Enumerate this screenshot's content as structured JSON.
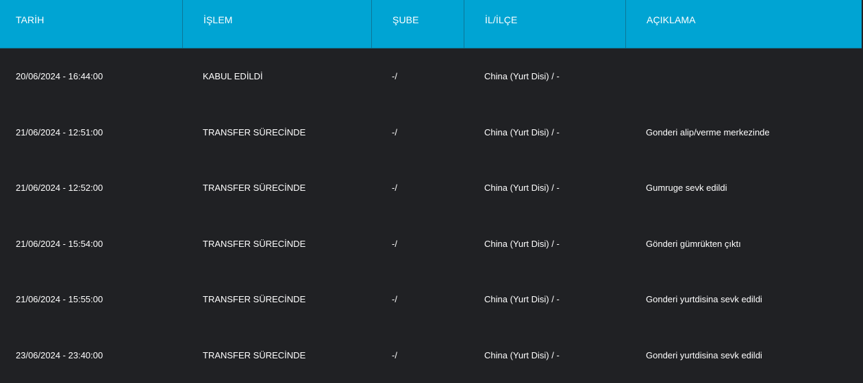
{
  "headers": {
    "date": "TARİH",
    "operation": "İŞLEM",
    "branch": "ŞUBE",
    "city": "İL/İLÇE",
    "description": "AÇIKLAMA"
  },
  "rows": [
    {
      "date": "20/06/2024 - 16:44:00",
      "operation": "KABUL EDİLDİ",
      "branch": "-/",
      "city": "China (Yurt Disi) / -",
      "description": ""
    },
    {
      "date": "21/06/2024 - 12:51:00",
      "operation": "TRANSFER SÜRECİNDE",
      "branch": "-/",
      "city": "China (Yurt Disi) / -",
      "description": "Gonderi alip/verme merkezinde"
    },
    {
      "date": "21/06/2024 - 12:52:00",
      "operation": "TRANSFER SÜRECİNDE",
      "branch": "-/",
      "city": "China (Yurt Disi) / -",
      "description": "Gumruge sevk edildi"
    },
    {
      "date": "21/06/2024 - 15:54:00",
      "operation": "TRANSFER SÜRECİNDE",
      "branch": "-/",
      "city": "China (Yurt Disi) / -",
      "description": "Gönderi gümrükten çıktı"
    },
    {
      "date": "21/06/2024 - 15:55:00",
      "operation": "TRANSFER SÜRECİNDE",
      "branch": "-/",
      "city": "China (Yurt Disi) / -",
      "description": "Gonderi yurtdisina sevk edildi"
    },
    {
      "date": "23/06/2024 - 23:40:00",
      "operation": "TRANSFER SÜRECİNDE",
      "branch": "-/",
      "city": "China (Yurt Disi) / -",
      "description": "Gonderi yurtdisina sevk edildi"
    }
  ],
  "colors": {
    "header_bg": "#00a4d3",
    "body_bg": "#202124",
    "text": "#ffffff"
  }
}
